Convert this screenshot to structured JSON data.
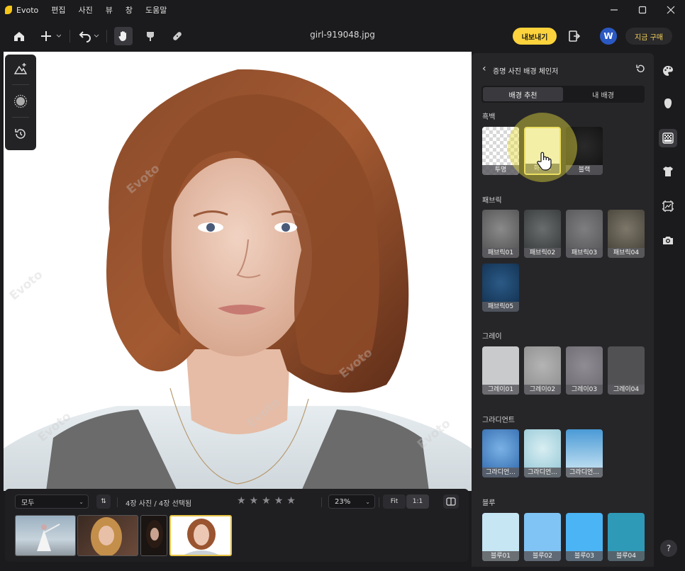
{
  "app": {
    "name": "Evoto",
    "menu": [
      "편집",
      "사진",
      "뷰",
      "창",
      "도움말"
    ],
    "file_name": "girl-919048.jpg"
  },
  "toolbar": {
    "export_label": "내보내기",
    "avatar_letter": "W",
    "buy_label": "지금 구매"
  },
  "canvas": {
    "watermark": "Evoto"
  },
  "filmstrip": {
    "filter_value": "모두",
    "count_text": "4장 사진 / 4장 선택됨",
    "rating_stars": 5,
    "zoom_value": "23%",
    "fit_label": "Fit",
    "one_to_one_label": "1:1",
    "thumbnail_count": 4,
    "selected_index": 4
  },
  "panel": {
    "title": "증명 사진 배경 체인저",
    "tabs": [
      "배경 추천",
      "내 배경"
    ],
    "active_tab": 0,
    "sections": {
      "bw": {
        "label": "흑백",
        "items": [
          "투명",
          "화이트",
          "블랙"
        ]
      },
      "fabric": {
        "label": "패브릭",
        "items": [
          "패브릭01",
          "패브릭02",
          "패브릭03",
          "패브릭04",
          "패브릭05"
        ]
      },
      "gray": {
        "label": "그레이",
        "items": [
          "그레이01",
          "그레이02",
          "그레이03",
          "그레이04"
        ]
      },
      "gradient": {
        "label": "그라디언트",
        "items": [
          "그라디언...",
          "그라디언...",
          "그라디언..."
        ]
      },
      "blue": {
        "label": "블루",
        "items": [
          "블루01",
          "블루02",
          "블루03",
          "블루04"
        ]
      }
    }
  },
  "colors": {
    "accent_yellow": "#fcd33c",
    "brand_blue": "#2b59c3",
    "panel_bg": "#262629"
  },
  "help_label": "?"
}
